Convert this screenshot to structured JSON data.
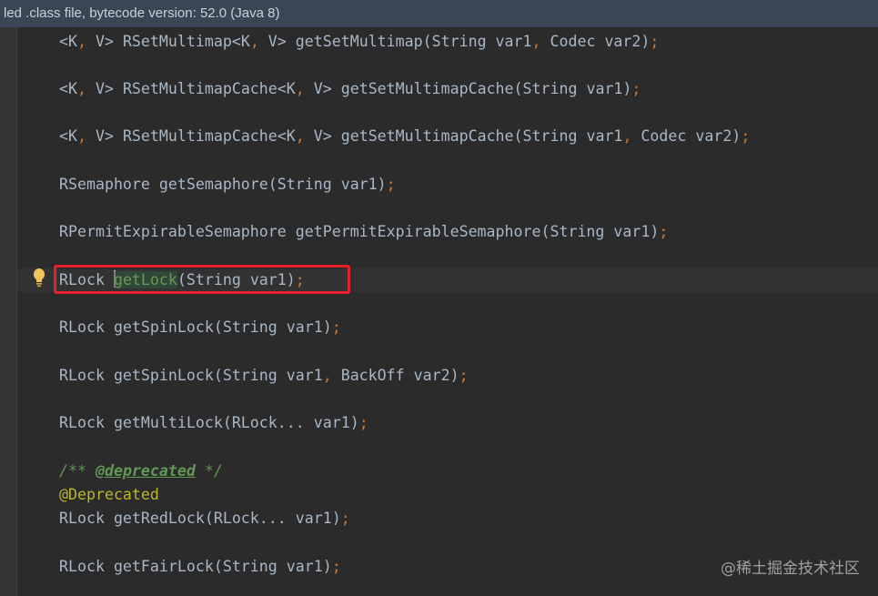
{
  "banner": {
    "text": "led .class file, bytecode version: 52.0 (Java 8)"
  },
  "code": {
    "lines": [
      {
        "text": "<K, V> RSetMultimap<K, V> getSetMultimap(String var1, Codec var2);"
      },
      {
        "text": "<K, V> RSetMultimapCache<K, V> getSetMultimapCache(String var1);"
      },
      {
        "text": "<K, V> RSetMultimapCache<K, V> getSetMultimapCache(String var1, Codec var2);"
      },
      {
        "text": "RSemaphore getSemaphore(String var1);"
      },
      {
        "text": "RPermitExpirableSemaphore getPermitExpirableSemaphore(String var1);"
      },
      {
        "text": "RLock getLock(String var1);"
      },
      {
        "text": "RLock getSpinLock(String var1);"
      },
      {
        "text": "RLock getSpinLock(String var1, BackOff var2);"
      },
      {
        "text": "RLock getMultiLock(RLock... var1);"
      },
      {
        "text": "/** @deprecated */"
      },
      {
        "text": "@Deprecated"
      },
      {
        "text": "RLock getRedLock(RLock... var1);"
      },
      {
        "text": "RLock getFairLock(String var1);"
      }
    ]
  },
  "editor": {
    "highlighted_line": 6,
    "gutter_icon": "lightbulb-icon",
    "highlight_color": "#e6202a"
  },
  "watermark": {
    "text": "@稀土掘金技术社区"
  },
  "colors": {
    "background": "#2b2b2b",
    "text": "#a9b7c6",
    "keyword_punct": "#cc7832",
    "comment": "#629755",
    "annotation": "#bbb529",
    "banner": "#3b4655"
  }
}
